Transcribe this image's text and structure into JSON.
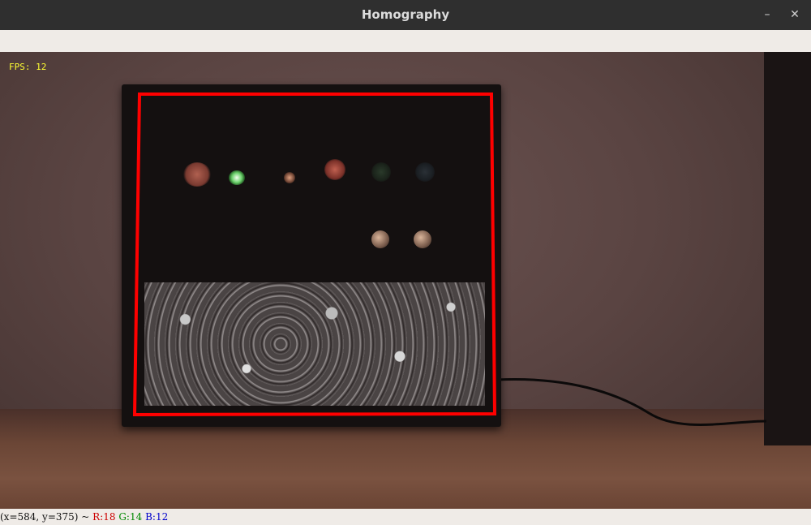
{
  "window": {
    "title": "Homography",
    "minimize_icon": "minimize-icon",
    "close_icon": "close-icon"
  },
  "overlay": {
    "fps_label": "FPS: 12"
  },
  "detection": {
    "outline_color": "#ff0000"
  },
  "status": {
    "coords": "(x=584, y=375) ~",
    "r": "R:18",
    "g": "G:14",
    "b": "B:12"
  }
}
